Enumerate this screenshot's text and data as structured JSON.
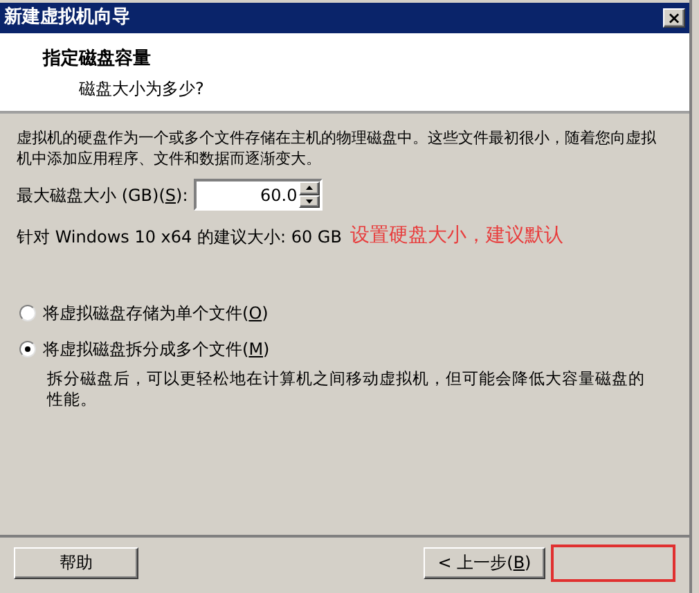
{
  "window": {
    "title": "新建虚拟机向导",
    "close": "×"
  },
  "header": {
    "title": "指定磁盘容量",
    "subtitle": "磁盘大小为多少?"
  },
  "description": "虚拟机的硬盘作为一个或多个文件存储在主机的物理磁盘中。这些文件最初很小，随着您向虚拟机中添加应用程序、文件和数据而逐渐变大。",
  "disk_size": {
    "label_before": "最大磁盘大小 (GB)(",
    "mnemonic": "S",
    "label_after": "):",
    "value": "60.0"
  },
  "recommendation": "针对 Windows 10 x64 的建议大小: 60 GB",
  "annotation": "设置硬盘大小，建议默认",
  "options": [
    {
      "label_before": "将虚拟磁盘存储为单个文件(",
      "mnemonic": "O",
      "label_after": ")",
      "selected": false
    },
    {
      "label_before": "将虚拟磁盘拆分成多个文件(",
      "mnemonic": "M",
      "label_after": ")",
      "selected": true,
      "note": "拆分磁盘后，可以更轻松地在计算机之间移动虚拟机，但可能会降低大容量磁盘的性能。"
    }
  ],
  "buttons": [
    {
      "kind": "help",
      "label_before": "帮助"
    },
    {
      "kind": "back",
      "label_before": "< 上一步(",
      "mnemonic": "B",
      "label_after": ")"
    },
    {
      "kind": "highlighted"
    }
  ]
}
